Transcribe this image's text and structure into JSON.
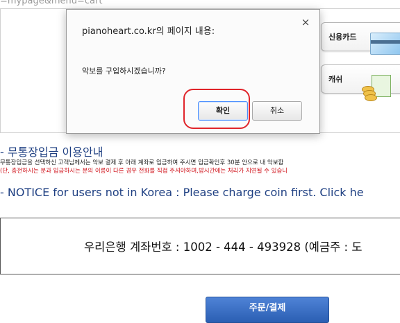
{
  "url_fragment": "=mypage&menu=cart",
  "payment_options": {
    "card_label": "신용카드",
    "cash_label": "캐쉬"
  },
  "dialog": {
    "title": "pianoheart.co.kr의 페이지 내용:",
    "close_glyph": "×",
    "message": "악보를 구입하시겠습니까?",
    "ok_label": "확인",
    "cancel_label": "취소"
  },
  "bank_section": {
    "title": "- 무통장입금 이용안내",
    "description": "무통장입금을 선택하신 고객님께서는 악보 결제 후 아래 계좌로 입금하여 주시면 입금확인후 30분 안으로 내 악보함",
    "warning": "(단, 충전하시는 분과 입금하시는 분의 이름이 다른 경우 전화를 직접 주셔야하며,밤시간에는 처리가 지연될 수 있습니",
    "notice": "- NOTICE for users not in Korea : Please charge coin first.  Click he",
    "account_text": "우리은행   계좌번호 : 1002 - 444 - 493928 (예금주 : 도"
  },
  "checkout_label": "주문/결제"
}
